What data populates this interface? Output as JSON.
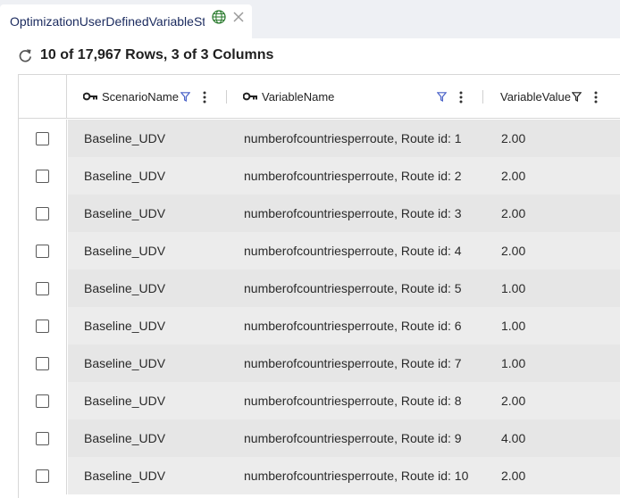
{
  "tab": {
    "label": "OptimizationUserDefinedVariableSt",
    "globe_icon": "globe-icon",
    "close_icon": "close-icon"
  },
  "status": {
    "text": "10 of 17,967 Rows, 3 of 3 Columns",
    "refresh_icon": "refresh-icon"
  },
  "columns": [
    {
      "label": "ScenarioName",
      "key": true,
      "filter_active": true
    },
    {
      "label": "VariableName",
      "key": true,
      "filter_active": true
    },
    {
      "label": "VariableValue",
      "key": false,
      "filter_active": false
    }
  ],
  "rows": [
    {
      "scenario": "Baseline_UDV",
      "variable": "numberofcountriesperroute, Route id: 1",
      "value": "2.00"
    },
    {
      "scenario": "Baseline_UDV",
      "variable": "numberofcountriesperroute, Route id: 2",
      "value": "2.00"
    },
    {
      "scenario": "Baseline_UDV",
      "variable": "numberofcountriesperroute, Route id: 3",
      "value": "2.00"
    },
    {
      "scenario": "Baseline_UDV",
      "variable": "numberofcountriesperroute, Route id: 4",
      "value": "2.00"
    },
    {
      "scenario": "Baseline_UDV",
      "variable": "numberofcountriesperroute, Route id: 5",
      "value": "1.00"
    },
    {
      "scenario": "Baseline_UDV",
      "variable": "numberofcountriesperroute, Route id: 6",
      "value": "1.00"
    },
    {
      "scenario": "Baseline_UDV",
      "variable": "numberofcountriesperroute, Route id: 7",
      "value": "1.00"
    },
    {
      "scenario": "Baseline_UDV",
      "variable": "numberofcountriesperroute, Route id: 8",
      "value": "2.00"
    },
    {
      "scenario": "Baseline_UDV",
      "variable": "numberofcountriesperroute, Route id: 9",
      "value": "4.00"
    },
    {
      "scenario": "Baseline_UDV",
      "variable": "numberofcountriesperroute, Route id: 10",
      "value": "2.00"
    }
  ],
  "colors": {
    "tab_text": "#1a2a5e",
    "filter_active": "#4a62c8",
    "globe": "#2e7d32"
  }
}
